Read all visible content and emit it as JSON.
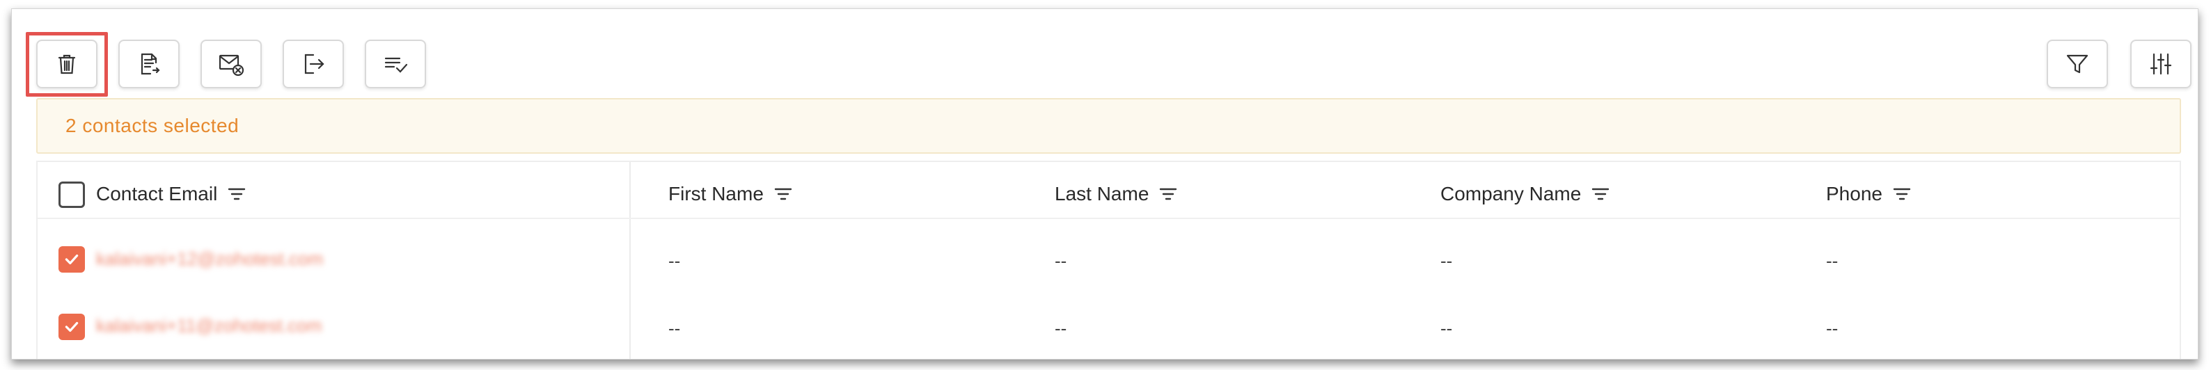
{
  "toolbar": {
    "buttons": [
      {
        "icon": "trash-icon",
        "label": "Delete"
      },
      {
        "icon": "document-export-icon",
        "label": "Export"
      },
      {
        "icon": "mail-unsubscribe-icon",
        "label": "Unsubscribe"
      },
      {
        "icon": "move-out-icon",
        "label": "Move"
      },
      {
        "icon": "list-check-icon",
        "label": "Mark"
      }
    ],
    "right_buttons": [
      {
        "icon": "filter-icon"
      },
      {
        "icon": "sliders-icon"
      }
    ]
  },
  "selection_banner": {
    "text": "2 contacts selected"
  },
  "table": {
    "columns": [
      "Contact Email",
      "First Name",
      "Last Name",
      "Company Name",
      "Phone"
    ],
    "rows": [
      {
        "selected": true,
        "email": "kalaivani+12@zohotest.com",
        "first_name": "--",
        "last_name": "--",
        "company": "--",
        "phone": "--"
      },
      {
        "selected": true,
        "email": "kalaivani+11@zohotest.com",
        "first_name": "--",
        "last_name": "--",
        "company": "--",
        "phone": "--"
      }
    ]
  },
  "colors": {
    "accent": "#ec6c4d",
    "highlight": "#e4534f",
    "banner_bg": "#fdf9ee",
    "banner_text": "#e6892e"
  }
}
